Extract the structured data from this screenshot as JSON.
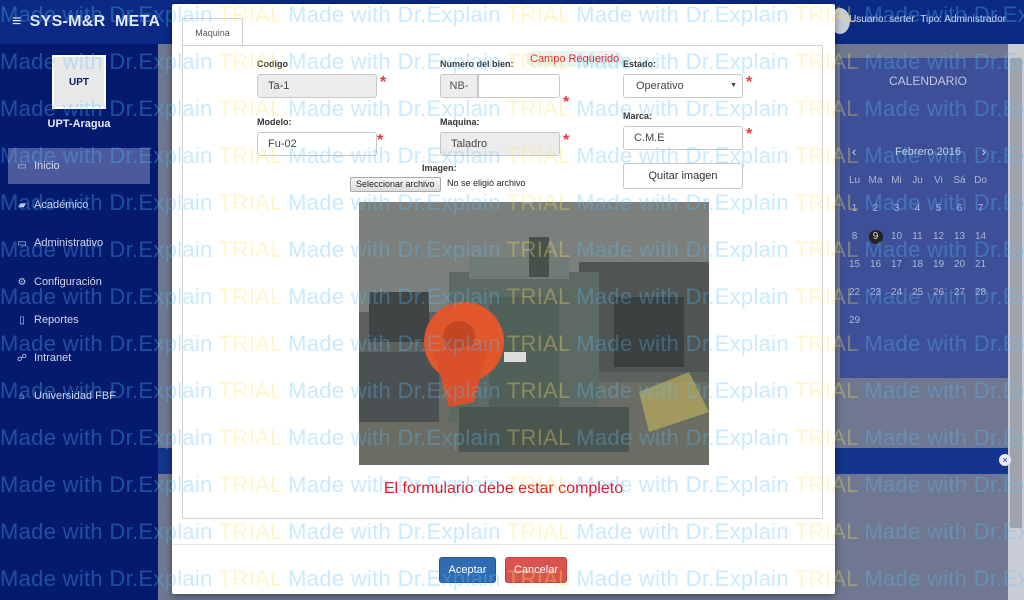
{
  "app": {
    "brand": "SYS-M&R",
    "brand_suffix": "META",
    "user_label": "Usuario: serter",
    "type_label": "Tipo: Administrador"
  },
  "sidebar": {
    "logo_text": "UPT",
    "institution": "UPT-Aragua",
    "items": [
      {
        "label": "Inicio",
        "icon": "home-icon"
      },
      {
        "label": "Académico",
        "icon": "book-icon"
      },
      {
        "label": "Administrativo",
        "icon": "monitor-icon"
      },
      {
        "label": "Configuración",
        "icon": "gears-icon"
      },
      {
        "label": "Reportes",
        "icon": "file-icon"
      },
      {
        "label": "Intranet",
        "icon": "sitemap-icon"
      },
      {
        "label": "Universidad FBF",
        "icon": "institution-icon"
      }
    ]
  },
  "calendar": {
    "title": "CALENDARIO",
    "month": "Febrero 2016",
    "weekdays": [
      "Lu",
      "Ma",
      "Mi",
      "Ju",
      "Vi",
      "Sá",
      "Do"
    ],
    "days": [
      "1",
      "2",
      "3",
      "4",
      "5",
      "6",
      "7",
      "8",
      "9",
      "10",
      "11",
      "12",
      "13",
      "14",
      "15",
      "16",
      "17",
      "18",
      "19",
      "20",
      "21",
      "22",
      "23",
      "24",
      "25",
      "26",
      "27",
      "28",
      "29"
    ],
    "today": "9"
  },
  "modal": {
    "tab_label": "Maquina",
    "fields": {
      "codigo": {
        "label": "Codigo",
        "value": "Ta-1"
      },
      "numero_bien": {
        "label": "Numero del bien:",
        "prefix": "NB-",
        "value": ""
      },
      "estado": {
        "label": "Estado:",
        "value": "Operativo"
      },
      "modelo": {
        "label": "Modelo:",
        "value": "Fu-02"
      },
      "maquina": {
        "label": "Maquina:",
        "value": "Taladro"
      },
      "marca": {
        "label": "Marca:",
        "value": "C.M.E"
      },
      "imagen": {
        "label": "Imagen:",
        "file_button": "Seleccionar archivo",
        "file_status": "No se eligió archivo"
      }
    },
    "campo_requerido": "Campo Requerido",
    "quitar_imagen": "Quitar imagen",
    "required_mark": "*",
    "error": "El formulario debe estar completo",
    "accept": "Aceptar",
    "cancel": "Cancelar"
  },
  "watermark": {
    "text_a": "Made with Dr.Explain ",
    "text_b": "TRIAL"
  },
  "colors": {
    "accent_blue": "#2f6bb0",
    "danger_red": "#d9534f",
    "error_red": "#e0171b",
    "sidebar_navy": "#041a6e"
  }
}
